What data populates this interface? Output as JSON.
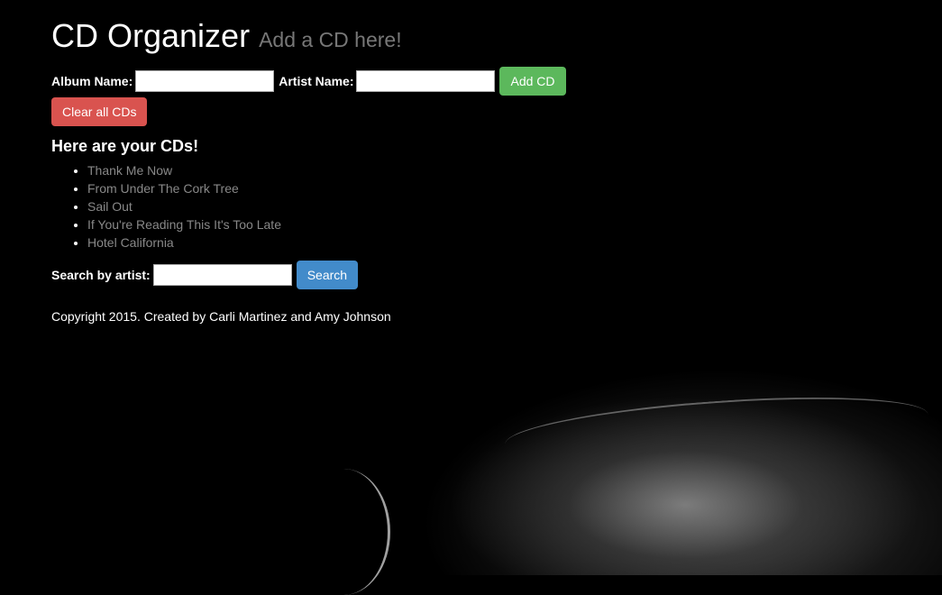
{
  "header": {
    "title": "CD Organizer",
    "subtitle": "Add a CD here!"
  },
  "form": {
    "album_label": "Album Name:",
    "album_value": "",
    "artist_label": "Artist Name:",
    "artist_value": "",
    "add_label": "Add CD",
    "clear_label": "Clear all CDs"
  },
  "list": {
    "heading": "Here are your CDs!",
    "items": [
      "Thank Me Now",
      "From Under The Cork Tree",
      "Sail Out",
      "If You're Reading This It's Too Late",
      "Hotel California"
    ]
  },
  "search": {
    "label": "Search by artist:",
    "value": "",
    "button_label": "Search"
  },
  "footer": {
    "copyright": "Copyright 2015. Created by Carli Martinez and Amy Johnson"
  },
  "colors": {
    "add": "#5cb85c",
    "clear": "#d9534f",
    "search": "#428bca",
    "link": "#888888"
  }
}
